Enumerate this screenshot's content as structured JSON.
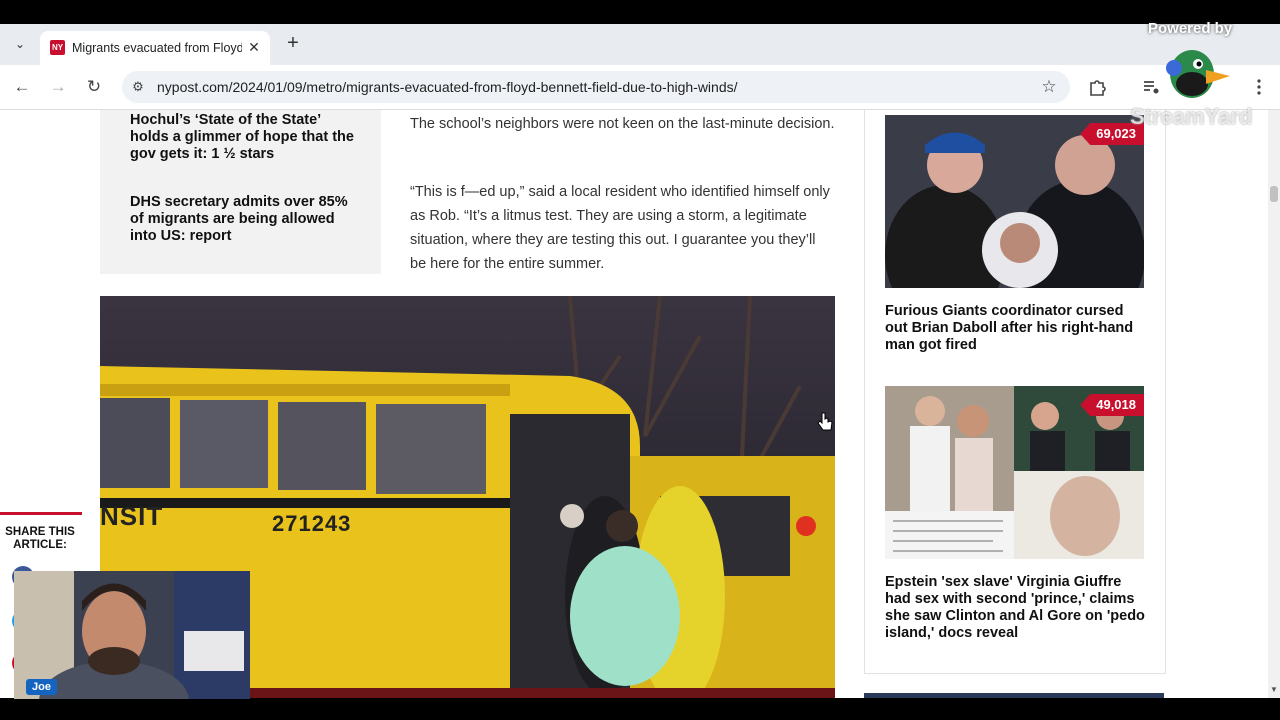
{
  "tab": {
    "favicon_text": "NY",
    "title": "Migrants evacuated from Floyd",
    "close": "✕",
    "new_tab": "+",
    "dropdown": "⌄"
  },
  "toolbar": {
    "back": "←",
    "forward": "→",
    "reload": "↻",
    "site_info": "⚙",
    "url": "nypost.com/2024/01/09/metro/migrants-evacuated-from-floyd-bennett-field-due-to-high-winds/",
    "star": "☆"
  },
  "related": [
    "Hochul’s ‘State of the State’ holds a glimmer of hope that the gov gets it: 1 ½ stars",
    "DHS secretary admits over 85% of migrants are being allowed into US: report"
  ],
  "article": {
    "paragraphs": [
      "The school’s neighbors were not keen on the last-minute decision.",
      "“This is f—ed up,” said a local resident who identified himself only as Rob. “It’s a litmus test. They are using a storm, a legitimate situation, where they are testing this out. I guarantee you they’ll be here for the entire summer."
    ],
    "bus_text": "NSIT",
    "bus_number": "271243"
  },
  "share": {
    "label": "SHARE THIS ARTICLE:"
  },
  "sidebar": {
    "items": [
      {
        "count": "69,023",
        "headline": "Furious Giants coordinator cursed out Brian Daboll after his right-hand man got fired"
      },
      {
        "count": "49,018",
        "headline": "Epstein 'sex slave' Virginia Giuffre had sex with second 'prince,' claims she saw Clinton and Al Gore on 'pedo island,' docs reveal"
      }
    ]
  },
  "overlay": {
    "powered_by": "Powered by",
    "brand": "StreamYard",
    "webcam_name": "Joe"
  },
  "colors": {
    "accent_red": "#c8102e",
    "bus_yellow": "#e9c21c"
  }
}
